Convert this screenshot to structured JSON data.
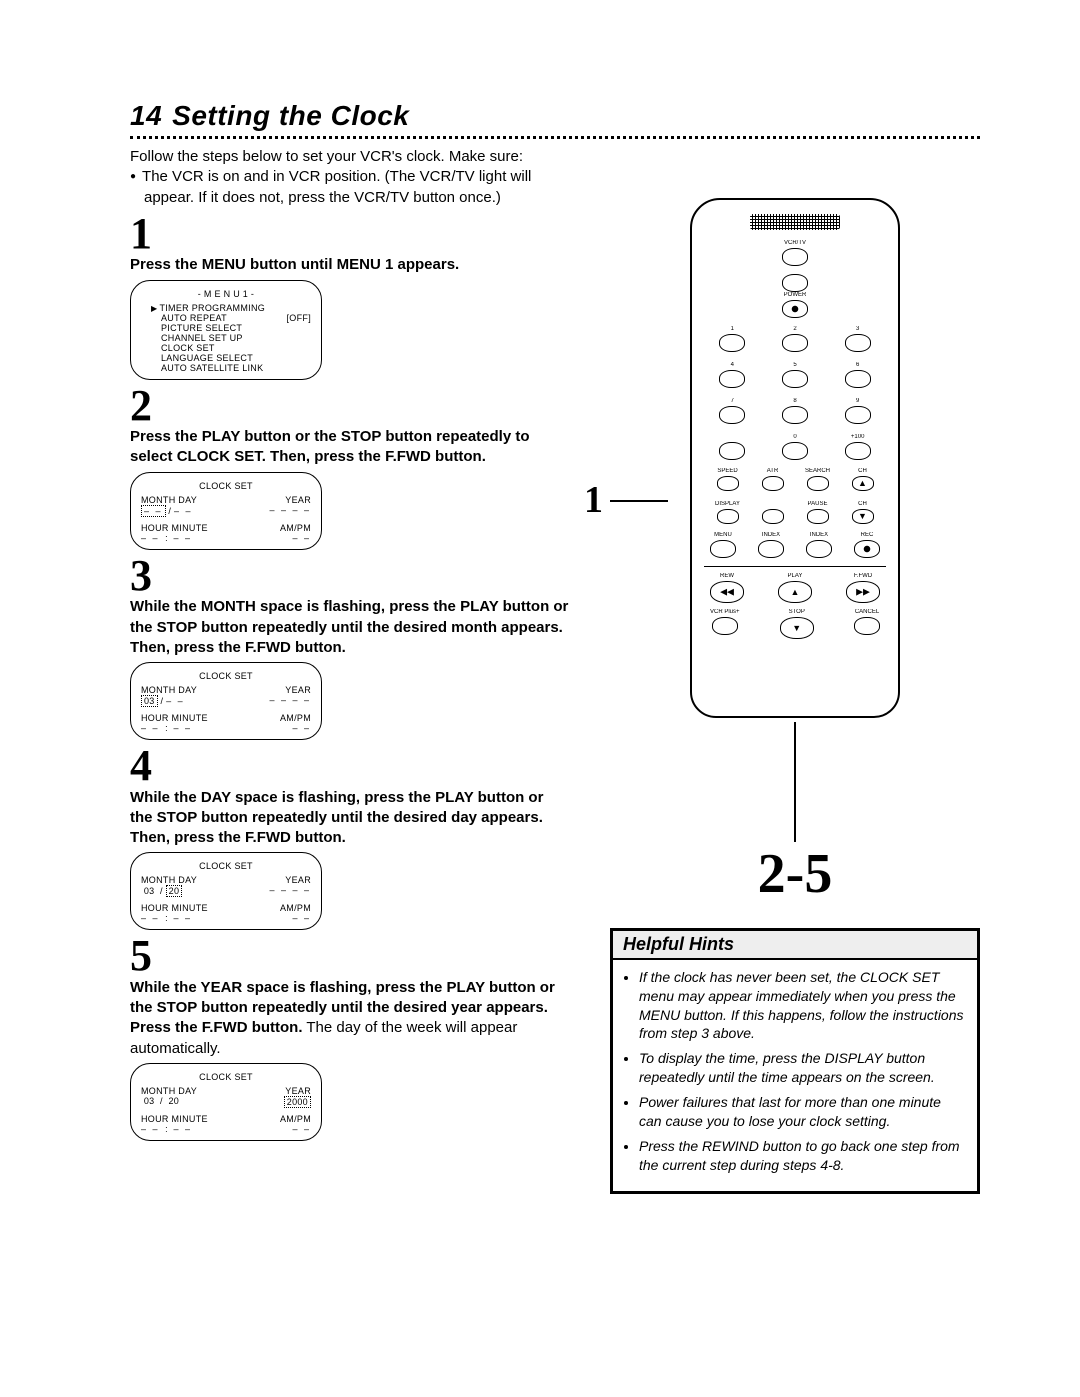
{
  "page_number": "14",
  "title": "Setting the Clock",
  "intro": {
    "line1": "Follow the steps below to set your VCR's clock.  Make sure:",
    "bullet1": "The VCR is on and in VCR position. (The VCR/TV light will",
    "bullet1b": "appear. If it does not, press the VCR/TV button once.)"
  },
  "steps": [
    {
      "num": "1",
      "text": "Press the MENU button until MENU 1 appears.",
      "screen_type": "menu1"
    },
    {
      "num": "2",
      "text": "Press the PLAY button or the STOP button repeatedly to select CLOCK SET. Then, press the F.FWD button.",
      "screen_type": "clock_blank_month"
    },
    {
      "num": "3",
      "text": "While the MONTH space is flashing, press the PLAY button or the STOP button repeatedly until the desired month appears. Then, press the F.FWD button.",
      "screen_type": "clock_flash_month"
    },
    {
      "num": "4",
      "text": "While the DAY space is flashing, press the PLAY button or the STOP button repeatedly until the desired day appears. Then, press the F.FWD button.",
      "screen_type": "clock_flash_day"
    },
    {
      "num": "5",
      "text_bold": "While the YEAR space is flashing, press the PLAY button or the STOP button repeatedly until the desired year appears. Press the F.FWD button.",
      "text_plain": " The day of the week will appear automatically.",
      "screen_type": "clock_flash_year"
    }
  ],
  "menu1": {
    "title": "- M E N U 1 -",
    "items": [
      "TIMER PROGRAMMING",
      "AUTO REPEAT",
      "PICTURE SELECT",
      "CHANNEL SET UP",
      "CLOCK SET",
      "LANGUAGE SELECT",
      "AUTO SATELLITE LINK"
    ],
    "auto_repeat_val": "[OFF]"
  },
  "clock_screen": {
    "title": "CLOCK SET",
    "header1": "MONTH DAY",
    "header2": "YEAR",
    "header3": "HOUR MINUTE",
    "header4": "AM/PM",
    "dashes": "– –",
    "four_dashes": "– – – –",
    "slash": "/",
    "colon": ":",
    "month_val": "03",
    "day_val": "20",
    "year_val": "2000"
  },
  "remote": {
    "top_row": [
      "VCR/TV",
      "",
      "POWER"
    ],
    "num_labels": [
      "1",
      "2",
      "3",
      "4",
      "5",
      "6",
      "7",
      "8",
      "9",
      "",
      "0",
      "+100"
    ],
    "func_row1": [
      "SPEED",
      "ATR",
      "SEARCH",
      "CH"
    ],
    "func_row2": [
      "DISPLAY",
      "PAUSE",
      "CH"
    ],
    "rec_label": "REC",
    "rew_label": "REW",
    "play_label": "PLAY",
    "ffwd_label": "F.FWD",
    "stop_label": "STOP",
    "index_label1": "INDEX",
    "index_label2": "INDEX",
    "menu_label": "MENU",
    "vcrplus_label": "VCR Plus+",
    "cancel_label": "CANCEL",
    "callout_1": "1",
    "callout_25": "2-5"
  },
  "hints": {
    "title": "Helpful Hints",
    "items": [
      "If the clock has never been set, the CLOCK SET menu may appear immediately when you press the MENU button. If this happens, follow the instructions from step 3 above.",
      "To display the time, press the DISPLAY button repeatedly until the time appears on the screen.",
      "Power failures that last for more than one minute can cause you to lose your clock setting.",
      "Press the REWIND button to go back one step from the current step during steps 4-8."
    ]
  }
}
